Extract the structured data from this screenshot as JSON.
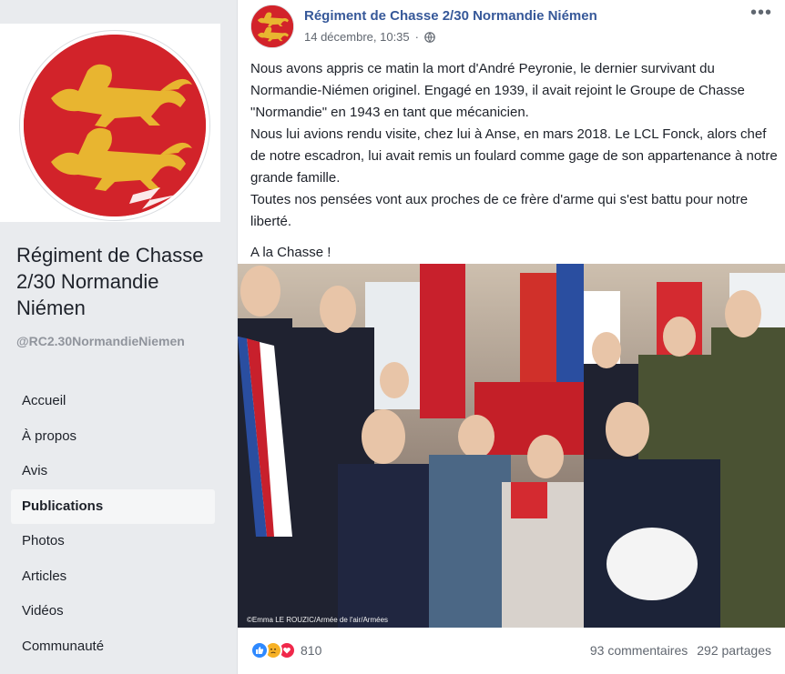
{
  "sidebar": {
    "page_name": "Régiment de Chasse 2/30 Normandie Niémen",
    "handle": "@RC2.30NormandieNiemen",
    "nav": [
      {
        "label": "Accueil",
        "active": false
      },
      {
        "label": "À propos",
        "active": false
      },
      {
        "label": "Avis",
        "active": false
      },
      {
        "label": "Publications",
        "active": true
      },
      {
        "label": "Photos",
        "active": false
      },
      {
        "label": "Articles",
        "active": false
      },
      {
        "label": "Vidéos",
        "active": false
      },
      {
        "label": "Communauté",
        "active": false
      }
    ]
  },
  "post": {
    "author": "Régiment de Chasse 2/30 Normandie Niémen",
    "timestamp": "14 décembre, 10:35",
    "privacy_icon": "globe-icon",
    "more_label": "•••",
    "paragraphs": [
      "Nous avons appris ce matin la mort d'André Peyronie, le dernier survivant du Normandie-Niémen originel. Engagé en 1939, il avait rejoint le Groupe de Chasse \"Normandie\" en 1943 en tant que mécanicien.",
      "Nous lui avions rendu visite, chez lui à Anse, en mars 2018. Le LCL Fonck, alors chef de notre escadron, lui avait remis un foulard comme gage de son appartenance à notre grande famille.",
      "Toutes nos pensées vont aux proches de ce frère d'arme qui s'est battu pour notre liberté.",
      "A la Chasse !"
    ],
    "photo_credit": "©Emma LE ROUZIC/Armée de l'air/Armées",
    "reaction_count": "810",
    "comments": "93 commentaires",
    "shares": "292 partages"
  },
  "colors": {
    "brand_red": "#d2232a",
    "lion_gold": "#e8b530",
    "link_blue": "#365899"
  }
}
